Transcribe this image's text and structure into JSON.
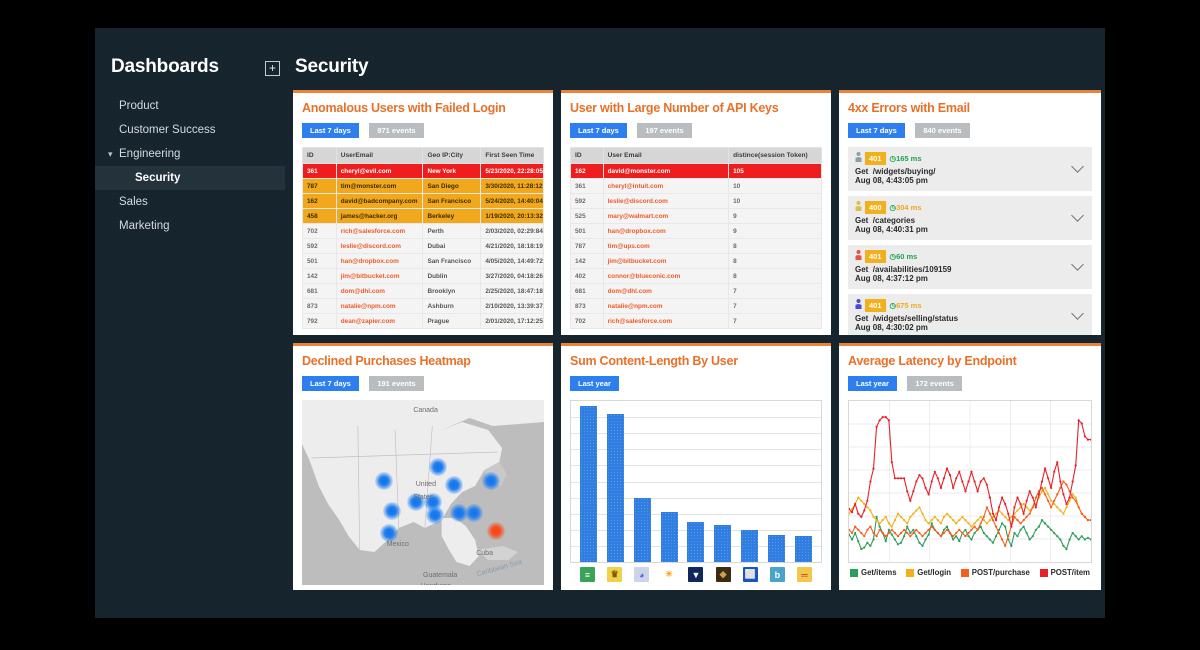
{
  "sidebar": {
    "title": "Dashboards",
    "add_icon": "plus-icon",
    "items": [
      {
        "label": "Product",
        "indent": false,
        "expandable": false,
        "active": false
      },
      {
        "label": "Customer Success",
        "indent": false,
        "expandable": false,
        "active": false
      },
      {
        "label": "Engineering",
        "indent": false,
        "expandable": true,
        "active": false
      },
      {
        "label": "Security",
        "indent": true,
        "expandable": false,
        "active": true
      },
      {
        "label": "Sales",
        "indent": false,
        "expandable": false,
        "active": false
      },
      {
        "label": "Marketing",
        "indent": false,
        "expandable": false,
        "active": false
      }
    ]
  },
  "header": {
    "page_title": "Security"
  },
  "colors": {
    "accent_orange": "#e8712a",
    "badge_blue": "#2d7ff0",
    "badge_grey": "#b9bdbf",
    "severity_red": "#ef1d1d",
    "severity_orange": "#f2a81c",
    "bar_blue": "#2f7ee0",
    "window_bg": "#16242e"
  },
  "panels": {
    "anomalous_users": {
      "title": "Anomalous Users with Failed Login",
      "range_badge": "Last 7 days",
      "events_badge": "971 events",
      "columns": [
        "ID",
        "UserEmail",
        "Geo IP:City",
        "First Seen Time"
      ],
      "rows": [
        {
          "severity": "red",
          "id": "361",
          "email": "cheryl@evil.com",
          "city": "New York",
          "time": "5/23/2020, 22:28:05"
        },
        {
          "severity": "orange",
          "id": "787",
          "email": "tim@monster.com",
          "city": "San Diego",
          "time": "3/30/2020, 11:28:12"
        },
        {
          "severity": "orange",
          "id": "162",
          "email": "david@badcompany.com",
          "city": "San Francisco",
          "time": "5/24/2020, 14:40:04"
        },
        {
          "severity": "orange",
          "id": "458",
          "email": "james@hacker.org",
          "city": "Berkeley",
          "time": "1/19/2020, 20:13:32"
        },
        {
          "severity": "none",
          "id": "702",
          "email": "rich@salesforce.com",
          "city": "Perth",
          "time": "2/03/2020, 02:29:84"
        },
        {
          "severity": "none",
          "id": "592",
          "email": "leslie@discord.com",
          "city": "Dubai",
          "time": "4/21/2020, 18:18:19"
        },
        {
          "severity": "none",
          "id": "501",
          "email": "han@dropbox.com",
          "city": "San Francisco",
          "time": "4/05/2020, 14:49:72"
        },
        {
          "severity": "none",
          "id": "142",
          "email": "jim@bitbucket.com",
          "city": "Dublin",
          "time": "3/27/2020, 04:18:26"
        },
        {
          "severity": "none",
          "id": "681",
          "email": "dom@dhl.com",
          "city": "Brooklyn",
          "time": "2/25/2020, 18:47:18"
        },
        {
          "severity": "none",
          "id": "873",
          "email": "natalie@npm.com",
          "city": "Ashburn",
          "time": "2/10/2020, 13:39:37"
        },
        {
          "severity": "none",
          "id": "792",
          "email": "dean@zapier.com",
          "city": "Prague",
          "time": "2/01/2020, 17:12:25"
        }
      ]
    },
    "api_keys": {
      "title": "User with Large Number of API Keys",
      "range_badge": "Last 7 days",
      "events_badge": "197 events",
      "columns": [
        "ID",
        "User Email",
        "distince(session Token)"
      ],
      "rows": [
        {
          "severity": "red",
          "id": "162",
          "email": "david@monster.com",
          "count": "105"
        },
        {
          "severity": "none",
          "id": "361",
          "email": "cheryl@intuit.com",
          "count": "10"
        },
        {
          "severity": "none",
          "id": "592",
          "email": "leslie@discord.com",
          "count": "10"
        },
        {
          "severity": "none",
          "id": "525",
          "email": "mary@walmart.com",
          "count": "9"
        },
        {
          "severity": "none",
          "id": "501",
          "email": "han@dropbox.com",
          "count": "9"
        },
        {
          "severity": "none",
          "id": "787",
          "email": "tim@ups.com",
          "count": "8"
        },
        {
          "severity": "none",
          "id": "142",
          "email": "jim@bitbucket.com",
          "count": "8"
        },
        {
          "severity": "none",
          "id": "402",
          "email": "connor@blueconic.com",
          "count": "8"
        },
        {
          "severity": "none",
          "id": "681",
          "email": "dom@dhl.com",
          "count": "7"
        },
        {
          "severity": "none",
          "id": "873",
          "email": "natalie@npm.com",
          "count": "7"
        },
        {
          "severity": "none",
          "id": "702",
          "email": "rich@salesforce.com",
          "count": "7"
        }
      ]
    },
    "errors_4xx": {
      "title": "4xx Errors with Email",
      "range_badge": "Last 7 days",
      "events_badge": "840 events",
      "items": [
        {
          "avatar_color": "#8aa0a8",
          "status": "401",
          "latency": "165 ms",
          "latency_color": "#1ea34a",
          "method": "Get",
          "path": "/widgets/buying/",
          "timestamp": "Aug 08, 4:43:05 pm",
          "expand_icon": "chevron-down-icon"
        },
        {
          "avatar_color": "#d6c24a",
          "status": "400",
          "latency": "304 ms",
          "latency_color": "#f2a81c",
          "method": "Get",
          "path": "/categories",
          "timestamp": "Aug 08, 4:40:31 pm",
          "expand_icon": "chevron-down-icon"
        },
        {
          "avatar_color": "#e0564a",
          "status": "401",
          "latency": "60 ms",
          "latency_color": "#1ea34a",
          "method": "Get",
          "path": "/availabilities/109159",
          "timestamp": "Aug 08, 4:37:12 pm",
          "expand_icon": "chevron-down-icon"
        },
        {
          "avatar_color": "#4a4ad6",
          "status": "401",
          "latency": "675 ms",
          "latency_color": "#f2a81c",
          "method": "Get",
          "path": "/widgets/selling/status",
          "timestamp": "Aug 08, 4:30:02 pm",
          "expand_icon": "chevron-down-icon"
        }
      ]
    },
    "heatmap": {
      "title": "Declined Purchases Heatmap",
      "range_badge": "Last 7 days",
      "events_badge": "191 events",
      "map_labels": [
        "Canada",
        "United",
        "States",
        "Mexico",
        "Cuba",
        "Guatemala",
        "Caribbean Sea",
        "Honduras"
      ],
      "points": [
        {
          "x": 34,
          "y": 44,
          "hot": false
        },
        {
          "x": 56,
          "y": 36,
          "hot": false
        },
        {
          "x": 63,
          "y": 46,
          "hot": false
        },
        {
          "x": 78,
          "y": 44,
          "hot": false
        },
        {
          "x": 54,
          "y": 55,
          "hot": false
        },
        {
          "x": 47,
          "y": 55,
          "hot": false
        },
        {
          "x": 37,
          "y": 60,
          "hot": false
        },
        {
          "x": 55,
          "y": 62,
          "hot": false
        },
        {
          "x": 65,
          "y": 61,
          "hot": false
        },
        {
          "x": 71,
          "y": 61,
          "hot": false
        },
        {
          "x": 36,
          "y": 72,
          "hot": false
        },
        {
          "x": 80,
          "y": 71,
          "hot": true
        }
      ]
    },
    "content_length": {
      "title": "Sum Content-Length By User",
      "range_badge": "Last year",
      "events_badge": ""
    },
    "latency": {
      "title": "Average Latency by Endpoint",
      "range_badge": "Last year",
      "events_badge": "172 events",
      "legend": [
        {
          "label": "Get/items",
          "color": "#2e9c5c"
        },
        {
          "label": "Get/login",
          "color": "#f2b01c"
        },
        {
          "label": "POST/purchase",
          "color": "#f2601c"
        },
        {
          "label": "POST/item",
          "color": "#e8202a"
        }
      ]
    }
  },
  "chart_data": [
    {
      "type": "bar",
      "title": "Sum Content-Length By User",
      "xlabel": "",
      "ylabel": "",
      "ylim": [
        0,
        100
      ],
      "grid": true,
      "legend_position": "none",
      "categories": [
        "slack",
        "confluence",
        "discord",
        "walmart",
        "dropbox",
        "ups",
        "bitbucket",
        "bing",
        "visa"
      ],
      "category_icons": [
        {
          "name": "slack-icon",
          "glyph": "≡",
          "bg": "#3aa35a",
          "fg": "#ffffff"
        },
        {
          "name": "confluence-icon",
          "glyph": "♛",
          "bg": "#f0d24a",
          "fg": "#7a5c00"
        },
        {
          "name": "discord-icon",
          "glyph": "◕",
          "bg": "#ccd4e8",
          "fg": "#5865f2"
        },
        {
          "name": "walmart-icon",
          "glyph": "☀",
          "bg": "#ffffff",
          "fg": "#f5a623"
        },
        {
          "name": "dropbox-icon",
          "glyph": "▼",
          "bg": "#10275e",
          "fg": "#ffffff"
        },
        {
          "name": "ups-icon",
          "glyph": "◆",
          "bg": "#3d2a12",
          "fg": "#c8a24a"
        },
        {
          "name": "bitbucket-icon",
          "glyph": "⬜",
          "bg": "#1a52c8",
          "fg": "#ffffff"
        },
        {
          "name": "bing-icon",
          "glyph": "b",
          "bg": "#4aa3c8",
          "fg": "#ffffff"
        },
        {
          "name": "visa-icon",
          "glyph": "═",
          "bg": "#f2c84a",
          "fg": "#c03030"
        }
      ],
      "values": [
        97,
        92,
        40,
        31,
        25,
        23,
        20,
        17,
        16
      ]
    },
    {
      "type": "line",
      "title": "Average Latency by Endpoint",
      "xlabel": "",
      "ylabel": "",
      "ylim": [
        0,
        100
      ],
      "grid": true,
      "legend_position": "bottom",
      "series": [
        {
          "name": "Get/items",
          "color": "#2e9c5c",
          "values": [
            17,
            14,
            18,
            13,
            8,
            9,
            12,
            10,
            14,
            28,
            22,
            18,
            13,
            20,
            17,
            14,
            11,
            12,
            16,
            22,
            18,
            20,
            16,
            12,
            10,
            14,
            17,
            24,
            20,
            18,
            16,
            20,
            22,
            18,
            14,
            16,
            13,
            18,
            20,
            16,
            14,
            18,
            20,
            22,
            18,
            16,
            14,
            12,
            16,
            20,
            24,
            22,
            14,
            10,
            18,
            16,
            20,
            22,
            18,
            14,
            16,
            20,
            22,
            26,
            24,
            22,
            20,
            18,
            16,
            14,
            10,
            8,
            14,
            18,
            16,
            14,
            16,
            14,
            15,
            14
          ]
        },
        {
          "name": "Get/login",
          "color": "#f2b01c",
          "values": [
            30,
            33,
            36,
            40,
            38,
            36,
            34,
            32,
            28,
            26,
            24,
            26,
            28,
            24,
            22,
            26,
            30,
            28,
            26,
            24,
            28,
            30,
            32,
            34,
            30,
            26,
            24,
            26,
            28,
            26,
            24,
            28,
            30,
            28,
            26,
            24,
            26,
            28,
            26,
            24,
            22,
            24,
            26,
            28,
            26,
            24,
            26,
            28,
            30,
            32,
            30,
            28,
            26,
            28,
            30,
            32,
            34,
            36,
            34,
            32,
            34,
            36,
            40,
            44,
            46,
            42,
            38,
            36,
            34,
            32,
            30,
            34,
            38,
            42,
            40,
            34,
            30,
            28,
            26,
            26
          ]
        },
        {
          "name": "POST/purchase",
          "color": "#f2601c",
          "values": [
            20,
            18,
            22,
            20,
            18,
            16,
            20,
            22,
            18,
            16,
            20,
            18,
            16,
            18,
            20,
            18,
            16,
            18,
            20,
            18,
            16,
            18,
            20,
            18,
            16,
            18,
            20,
            22,
            20,
            18,
            16,
            18,
            20,
            18,
            16,
            18,
            20,
            18,
            16,
            18,
            20,
            22,
            20,
            24,
            28,
            34,
            30,
            26,
            22,
            18,
            14,
            10,
            16,
            22,
            28,
            26,
            24,
            26,
            28,
            30,
            34,
            40,
            44,
            46,
            42,
            38,
            34,
            38,
            42,
            46,
            50,
            48,
            44,
            40,
            38,
            34,
            30,
            28,
            26,
            26
          ]
        },
        {
          "name": "POST/item",
          "color": "#e8202a",
          "values": [
            33,
            31,
            36,
            30,
            28,
            32,
            38,
            50,
            58,
            84,
            88,
            90,
            90,
            88,
            62,
            52,
            52,
            52,
            52,
            44,
            38,
            44,
            50,
            54,
            52,
            46,
            42,
            50,
            56,
            52,
            46,
            52,
            58,
            54,
            46,
            52,
            56,
            50,
            44,
            50,
            56,
            50,
            44,
            50,
            52,
            48,
            40,
            30,
            26,
            34,
            40,
            36,
            30,
            22,
            34,
            40,
            36,
            30,
            38,
            44,
            40,
            34,
            42,
            50,
            58,
            52,
            46,
            56,
            62,
            50,
            42,
            36,
            40,
            50,
            60,
            88,
            86,
            78,
            76,
            76
          ]
        }
      ]
    }
  ]
}
